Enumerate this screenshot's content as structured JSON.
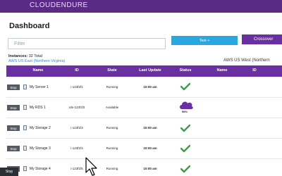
{
  "app": {
    "brand": "CLOUDENDURE"
  },
  "header": {
    "title": "Dashboard"
  },
  "filter": {
    "placeholder": "Filter"
  },
  "buttons": {
    "test_label": "Test +",
    "crossover_label": "Crossover"
  },
  "summary": {
    "instances_label": "Instances:",
    "instances_value": "32 Total",
    "source_region": "AWS US East (Northern Virginia)",
    "target_region": "AWS US West (Northern"
  },
  "table": {
    "headers": [
      "Name",
      "ID",
      "State",
      "Last Update",
      "Status",
      "Name",
      "ID"
    ],
    "rows": [
      {
        "action": "Stop",
        "name": "My Server 1",
        "id": "i-123f2f1",
        "state": "Running",
        "last_update": "10:00 am",
        "status": "check"
      },
      {
        "action": "Stop",
        "name": "My RDS 1",
        "id": "rds-123f1f2",
        "state": "Available",
        "last_update": "10:00 am",
        "status": "cloud",
        "status_text": "98%"
      },
      {
        "action": "Stop",
        "name": "My Storage 2",
        "id": "i-123f1f3",
        "state": "Running",
        "last_update": "10:00 am",
        "status": "check"
      },
      {
        "action": "Stop",
        "name": "My Storage 3",
        "id": "i-123f1f4",
        "state": "Running",
        "last_update": "10:00 am",
        "status": "check"
      },
      {
        "action": "Stop",
        "name": "My Storage 4",
        "id": "i-123f1f5",
        "state": "Running",
        "last_update": "10:00 am",
        "status": "check"
      }
    ]
  },
  "taskbar": {
    "label": "Stop"
  },
  "colors": {
    "purple": "#6a2fa0",
    "blue": "#29a8e0",
    "green": "#3c9a4a",
    "dark": "#555a62"
  }
}
